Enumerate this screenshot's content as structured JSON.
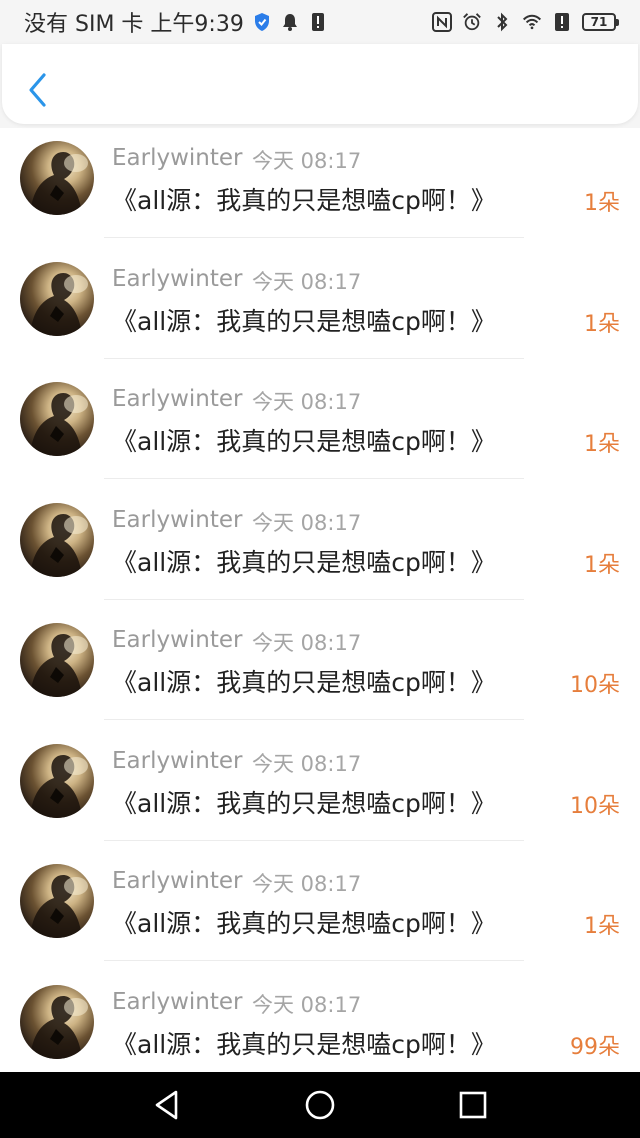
{
  "status_bar": {
    "carrier_time": "没有 SIM 卡 上午9:39",
    "battery_level": "71",
    "icons_left": [
      "shield-icon",
      "bell-icon",
      "alert-icon"
    ],
    "icons_right": [
      "nfc-icon",
      "alarm-icon",
      "bluetooth-icon",
      "wifi-icon",
      "alert-icon",
      "battery-icon"
    ]
  },
  "header": {
    "back_icon": "chevron-left-icon",
    "accent_color": "#2b95e9"
  },
  "list": {
    "items": [
      {
        "username": "Earlywinter",
        "time": "今天 08:17",
        "title": "《all源：我真的只是想嗑cp啊！》",
        "count": "1朵"
      },
      {
        "username": "Earlywinter",
        "time": "今天 08:17",
        "title": "《all源：我真的只是想嗑cp啊！》",
        "count": "1朵"
      },
      {
        "username": "Earlywinter",
        "time": "今天 08:17",
        "title": "《all源：我真的只是想嗑cp啊！》",
        "count": "1朵"
      },
      {
        "username": "Earlywinter",
        "time": "今天 08:17",
        "title": "《all源：我真的只是想嗑cp啊！》",
        "count": "1朵"
      },
      {
        "username": "Earlywinter",
        "time": "今天 08:17",
        "title": "《all源：我真的只是想嗑cp啊！》",
        "count": "10朵"
      },
      {
        "username": "Earlywinter",
        "time": "今天 08:17",
        "title": "《all源：我真的只是想嗑cp啊！》",
        "count": "10朵"
      },
      {
        "username": "Earlywinter",
        "time": "今天 08:17",
        "title": "《all源：我真的只是想嗑cp啊！》",
        "count": "1朵"
      },
      {
        "username": "Earlywinter",
        "time": "今天 08:17",
        "title": "《all源：我真的只是想嗑cp啊！》",
        "count": "99朵"
      }
    ],
    "count_color": "#e67e3c"
  },
  "nav_bar": {
    "icons": [
      "back-triangle-icon",
      "home-circle-icon",
      "recents-square-icon"
    ]
  }
}
